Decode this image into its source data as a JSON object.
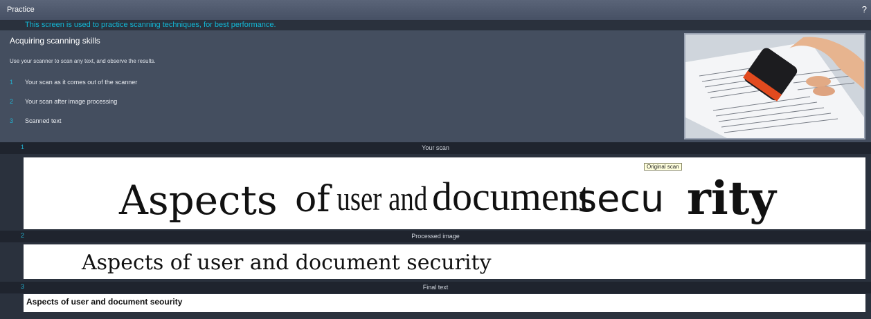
{
  "window": {
    "title": "Practice",
    "help_label": "?"
  },
  "subtitle": "This screen is used to practice scanning techniques, for best performance.",
  "info": {
    "heading": "Acquiring scanning skills",
    "description": "Use your scanner to scan any text, and observe the results.",
    "steps": [
      {
        "num": "1",
        "label": "Your scan as it comes out of the scanner"
      },
      {
        "num": "2",
        "label": "Your scan after image processing"
      },
      {
        "num": "3",
        "label": "Scanned text"
      }
    ]
  },
  "sections": {
    "scan": {
      "num": "1",
      "label": "Your scan"
    },
    "processed": {
      "num": "2",
      "label": "Processed image"
    },
    "final": {
      "num": "3",
      "label": "Final text"
    }
  },
  "scan": {
    "tooltip": "Original scan",
    "text_parts": [
      "Aspects",
      "of",
      "user and",
      "document",
      "secu",
      "rity"
    ]
  },
  "processed": {
    "text": "Aspects of user and document security"
  },
  "final": {
    "text": "Aspects of user and document seourity"
  },
  "colors": {
    "accent": "#21b4d4",
    "subtitle": "#12b8d6",
    "panel": "#444e5f",
    "background": "#2a313d",
    "section_header": "#1f242e"
  },
  "icons": {
    "scanner_illustration": "handheld-scanner-illustration"
  }
}
